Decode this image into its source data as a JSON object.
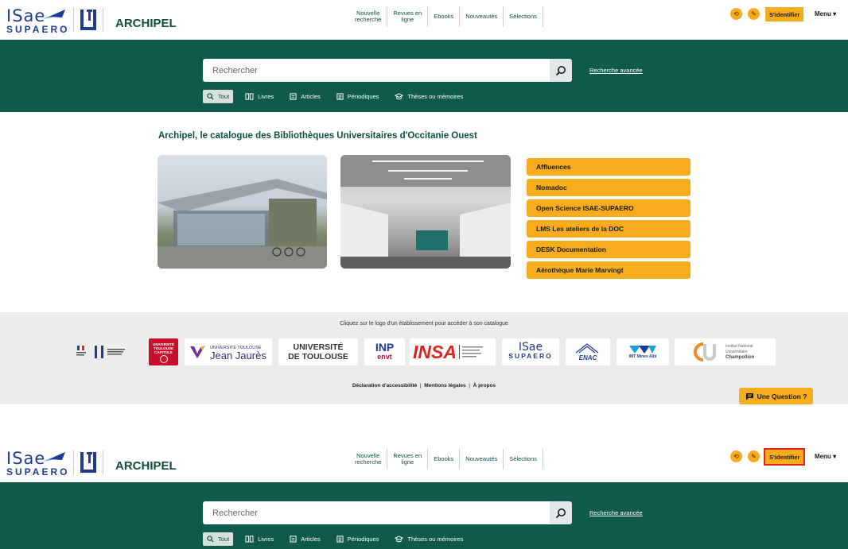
{
  "header": {
    "brand": "ARCHIPEL",
    "logo_isae_text": "ISae",
    "logo_isae_sub": "SUPAERO",
    "nav": [
      {
        "line1": "Nouvelle",
        "line2": "recherche"
      },
      {
        "line1": "Revues en",
        "line2": "ligne"
      },
      {
        "line1": "Ebooks",
        "line2": ""
      },
      {
        "line1": "Nouveautés",
        "line2": ""
      },
      {
        "line1": "Sélections",
        "line2": ""
      }
    ],
    "signin_label": "S'identifier",
    "menu_label": "Menu ▾"
  },
  "search": {
    "placeholder": "Rechercher",
    "advanced_label": "Recherche avancée",
    "types": [
      {
        "label": "Tout",
        "icon": "search-icon"
      },
      {
        "label": "Livres",
        "icon": "book-icon"
      },
      {
        "label": "Articles",
        "icon": "article-icon"
      },
      {
        "label": "Périodiques",
        "icon": "periodical-icon"
      },
      {
        "label": "Thèses ou mémoires",
        "icon": "graduation-cap-icon"
      }
    ]
  },
  "main": {
    "headline": "Archipel, le catalogue des Bibliothèques Universitaires d'Occitanie Ouest",
    "quick_links": [
      "Affluences",
      "Nomadoc",
      "Open Science ISAE-SUPAERO",
      "LMS Les ateliers de la DOC",
      "DESK Documentation",
      "Aérothèque Marie Marvingt"
    ]
  },
  "footer": {
    "caption": "Cliquez sur le logo d'un établissement pour accéder à son catalogue",
    "logos": {
      "utc": "UNIVERSITÉ TOULOUSE CAPITOLE",
      "ujj_small": "UNIVERSITÉ TOULOUSE",
      "ujj_big": "Jean Jaurès",
      "ut1": "UNIVERSITÉ",
      "ut2": "DE TOULOUSE",
      "inp": "INP",
      "envt": "envt",
      "insa": "INSA",
      "enac": "ENAC",
      "imt": "IMT Mines Albi",
      "champo1": "Institut National",
      "champo2": "Universitaire",
      "champo3": "Champollion"
    },
    "legal": [
      "Déclaration d'accessibilité",
      "Mentions légales",
      "À propos"
    ],
    "legal_sep": "|"
  },
  "question_label": "Une Question ?",
  "colors": {
    "brand_green": "#0f5a4d",
    "accent_yellow": "#f6ac1c",
    "highlight_red": "#e0241b"
  }
}
